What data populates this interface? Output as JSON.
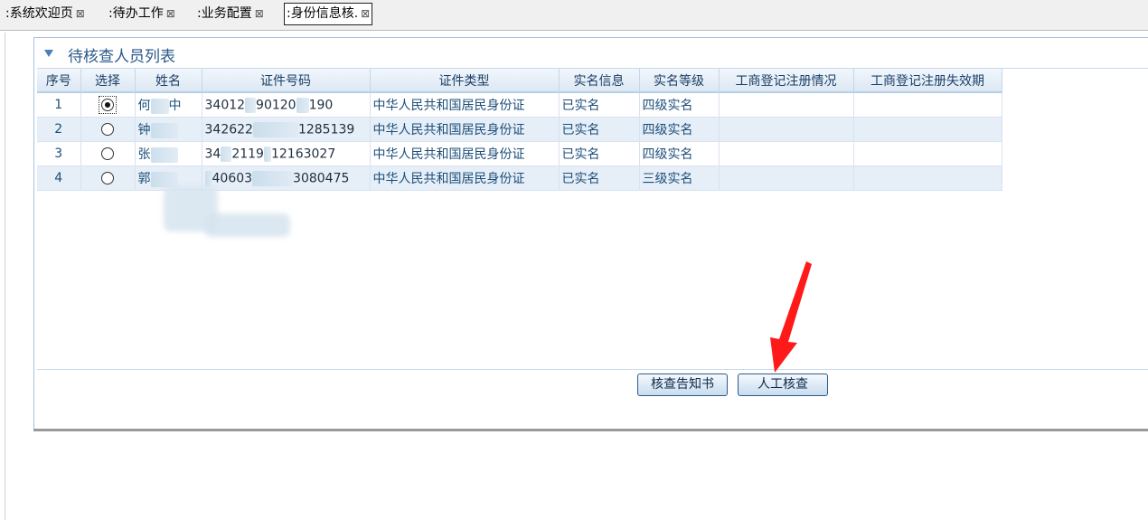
{
  "tabs": [
    {
      "label": ":系统欢迎页",
      "close": "⊠"
    },
    {
      "label": ":待办工作",
      "close": "⊠"
    },
    {
      "label": ":业务配置",
      "close": "⊠"
    },
    {
      "label": ":身份信息核.",
      "close": "⊠"
    }
  ],
  "panel": {
    "title": "待核查人员列表"
  },
  "table": {
    "columns": [
      "序号",
      "选择",
      "姓名",
      "证件号码",
      "证件类型",
      "实名信息",
      "实名等级",
      "工商登记注册情况",
      "工商登记注册失效期"
    ],
    "rows": [
      {
        "no": "1",
        "name_a": "何",
        "name_b": "中",
        "id_a": "34012",
        "id_b": "90120",
        "id_c": "190",
        "id_type": "中华人民共和国居民身份证",
        "realname": "已实名",
        "level": "四级实名",
        "reg": "",
        "expiry": ""
      },
      {
        "no": "2",
        "name_a": "钟",
        "name_b": "",
        "id_a": "342622",
        "id_b": "",
        "id_c": "1285139",
        "id_type": "中华人民共和国居民身份证",
        "realname": "已实名",
        "level": "四级实名",
        "reg": "",
        "expiry": ""
      },
      {
        "no": "3",
        "name_a": "张",
        "name_b": "",
        "id_a": "34",
        "id_b": "2119",
        "id_c": "12163027",
        "id_type": "中华人民共和国居民身份证",
        "realname": "已实名",
        "level": "四级实名",
        "reg": "",
        "expiry": ""
      },
      {
        "no": "4",
        "name_a": "郭",
        "name_b": "",
        "id_a": "40603",
        "id_b": "",
        "id_c": "3080475",
        "id_type": "中华人民共和国居民身份证",
        "realname": "已实名",
        "level": "三级实名",
        "reg": "",
        "expiry": ""
      }
    ]
  },
  "buttons": {
    "notice": "核查告知书",
    "manual": "人工核查"
  },
  "colors": {
    "accent": "#2a5a8a",
    "arrow": "#ff1a1a",
    "row_alt": "#e6eef7"
  }
}
